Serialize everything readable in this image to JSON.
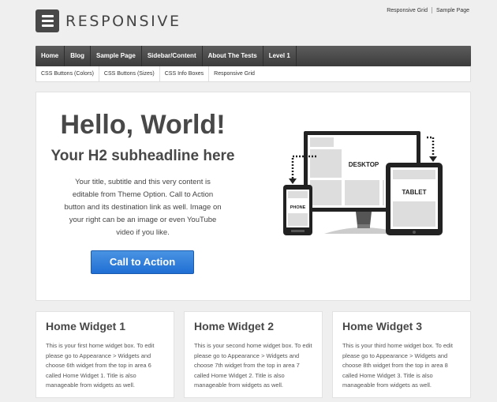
{
  "top_links": [
    "Responsive Grid",
    "Sample Page"
  ],
  "site": {
    "title": "RESPONSIVE"
  },
  "main_nav": [
    "Home",
    "Blog",
    "Sample Page",
    "Sidebar/Content",
    "About The Tests",
    "Level 1"
  ],
  "sub_nav": [
    "CSS Buttons (Colors)",
    "CSS Buttons (Sizes)",
    "CSS Info Boxes",
    "Responsive Grid"
  ],
  "hero": {
    "headline": "Hello, World!",
    "subheadline": "Your H2 subheadline here",
    "body": "Your title, subtitle and this very content is editable from Theme Option. Call to Action button and its destination link as well. Image on your right can be an image or even YouTube video if you like.",
    "cta_label": "Call to Action",
    "device_labels": {
      "desktop": "DESKTOP",
      "tablet": "TABLET",
      "phone": "PHONE"
    }
  },
  "widgets": [
    {
      "title": "Home Widget 1",
      "text": "This is your first home widget box. To edit please go to Appearance > Widgets and choose 6th widget from the top in area 6 called Home Widget 1. Title is also manageable from widgets as well."
    },
    {
      "title": "Home Widget 2",
      "text": "This is your second home widget box. To edit please go to Appearance > Widgets and choose 7th widget from the top in area 7 called Home Widget 2. Title is also manageable from widgets as well."
    },
    {
      "title": "Home Widget 3",
      "text": "This is your third home widget box. To edit please go to Appearance > Widgets and choose 8th widget from the top in area 8 called Home Widget 3. Title is also manageable from widgets as well."
    }
  ],
  "colors": {
    "nav_bg": "#484848",
    "cta_blue": "#2b7de0",
    "page_bg": "#efefef"
  }
}
